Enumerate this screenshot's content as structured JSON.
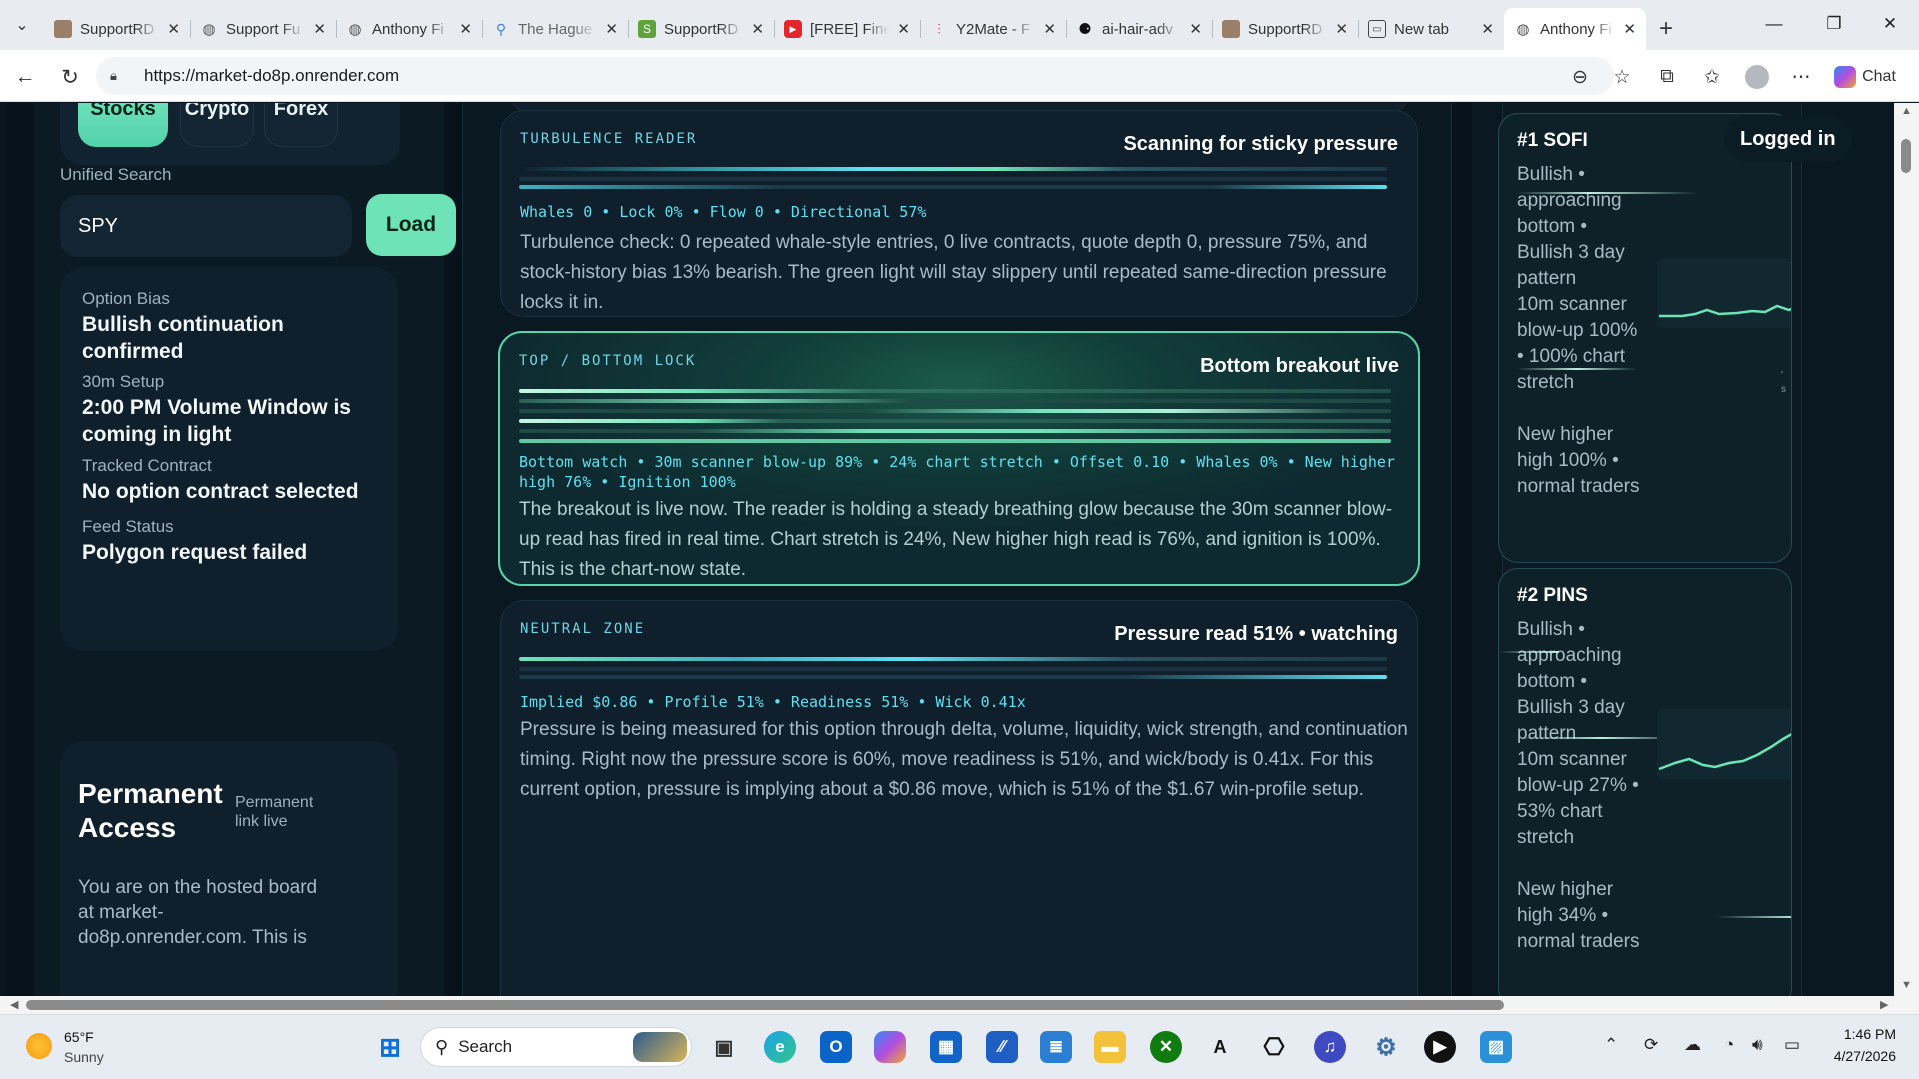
{
  "browser": {
    "tabs": [
      {
        "title": "SupportRD",
        "icon": "img-icon"
      },
      {
        "title": "Support Fu",
        "icon": "globe-icon"
      },
      {
        "title": "Anthony Fi",
        "icon": "globe-icon"
      },
      {
        "title": "The Hague",
        "icon": "search-icon"
      },
      {
        "title": "SupportRD",
        "icon": "shopify-icon"
      },
      {
        "title": "[FREE] Fine",
        "icon": "youtube-icon"
      },
      {
        "title": "Y2Mate - F",
        "icon": "y2mate-icon"
      },
      {
        "title": "ai-hair-adv",
        "icon": "render-icon"
      },
      {
        "title": "SupportRD",
        "icon": "img-icon"
      },
      {
        "title": "New tab",
        "icon": "newtab-icon"
      },
      {
        "title": "Anthony Fi",
        "icon": "globe-icon",
        "active": true
      }
    ],
    "url": "https://market-do8p.onrender.com",
    "chat_label": "Chat"
  },
  "left": {
    "markets": [
      "Stocks",
      "Crypto",
      "Forex"
    ],
    "active_market": "Stocks",
    "search_label": "Unified Search",
    "search_value": "SPY",
    "load_label": "Load",
    "info": [
      {
        "label": "Option Bias",
        "value": "Bullish continuation confirmed"
      },
      {
        "label": "30m Setup",
        "value": "2:00 PM Volume Window is coming in light"
      },
      {
        "label": "Tracked Contract",
        "value": "No option contract selected"
      },
      {
        "label": "Feed Status",
        "value": "Polygon request failed"
      }
    ],
    "permanent": {
      "title": "Permanent Access",
      "tag": "Permanent link live",
      "body": "You are on the hosted board at market-do8p.onrender.com. This is"
    }
  },
  "cards": [
    {
      "title": "TURBULENCE READER",
      "status": "Scanning for sticky pressure",
      "meta": "Whales 0 • Lock 0% • Flow 0 • Directional 57%",
      "body": "Turbulence check: 0 repeated whale-style entries, 0 live contracts, quote depth 0, pressure 75%, and stock-history bias 13% bearish. The green light will stay slippery until repeated same-direction pressure locks it in."
    },
    {
      "title": "TOP / BOTTOM LOCK",
      "status": "Bottom breakout live",
      "meta": "Bottom watch • 30m scanner blow-up 89% • 24% chart stretch • Offset 0.10 • Whales 0% • New higher high 76% • Ignition 100%",
      "body": "The breakout is live now. The reader is holding a steady breathing glow because the 30m scanner blow-up read has fired in real time. Chart stretch is 24%, New higher high read is 76%, and ignition is 100%. This is the chart-now state."
    },
    {
      "title": "NEUTRAL ZONE",
      "status": "Pressure read 51% • watching",
      "meta": "Implied $0.86 • Profile 51% • Readiness 51% • Wick 0.41x",
      "body": "Pressure is being measured for this option through delta, volume, liquidity, wick strength, and continuation timing. Right now the pressure score is 60%, move readiness is 51%, and wick/body is 0.41x. For this current option, pressure is implying about a $0.86 move, which is 51% of the $1.67 win-profile setup."
    }
  ],
  "right": {
    "badge": "Logged in",
    "items": [
      {
        "title": "#1 SOFI",
        "line1": "Bullish • approaching bottom • Bullish 3 day pattern",
        "line2": "10m scanner blow-up 100% • 100% chart stretch",
        "line3": "New higher high 100% • normal traders"
      },
      {
        "title": "#2 PINS",
        "line1": "Bullish • approaching bottom • Bullish 3 day pattern",
        "line2": "10m scanner blow-up 27% • 53% chart stretch",
        "line3": "New higher high 34% • normal traders"
      }
    ]
  },
  "taskbar": {
    "weather_temp": "65°F",
    "weather_cond": "Sunny",
    "search_label": "Search",
    "time": "1:46 PM",
    "date": "4/27/2026"
  },
  "colors": {
    "accent": "#6ee3b7",
    "cyan": "#5fe0f0",
    "bg": "#07121a"
  }
}
